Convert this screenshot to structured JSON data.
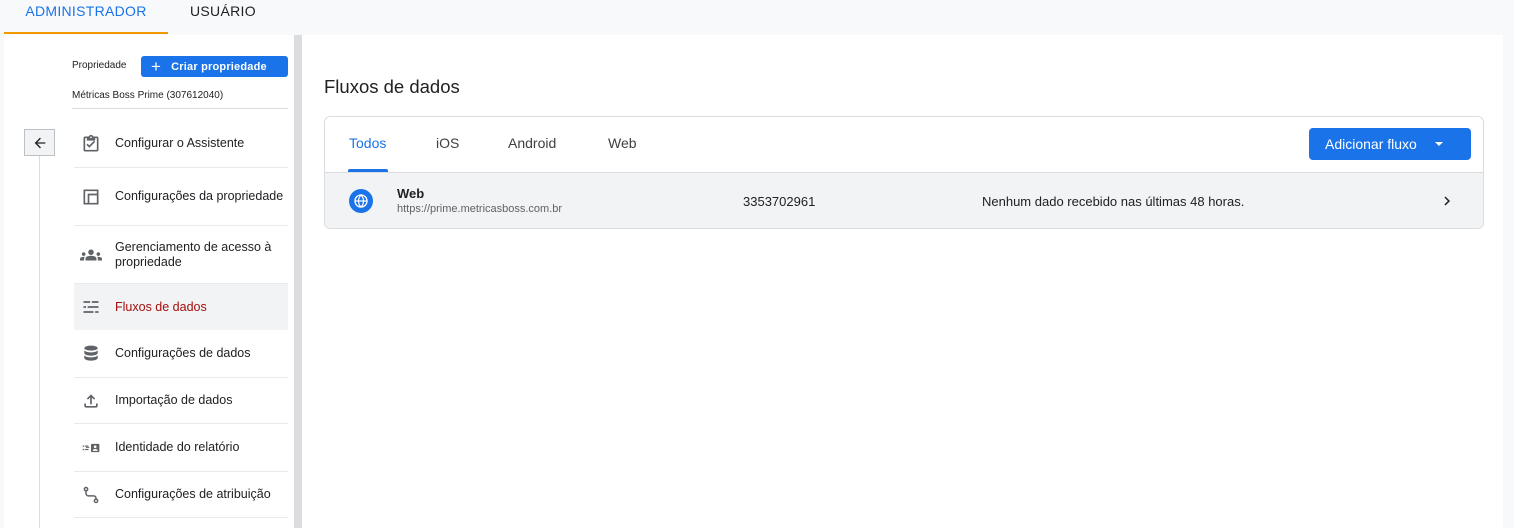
{
  "top_tabs": {
    "admin": "ADMINISTRADOR",
    "user": "USUÁRIO"
  },
  "sidebar": {
    "property_label": "Propriedade",
    "create_property": "Criar propriedade",
    "property_name": "Métricas Boss Prime (307612040)",
    "items": [
      {
        "label": "Configurar o Assistente",
        "icon": "checklist-icon"
      },
      {
        "label": "Configurações da propriedade",
        "icon": "property-settings-icon"
      },
      {
        "label": "Gerenciamento de acesso à propriedade",
        "icon": "people-icon"
      },
      {
        "label": "Fluxos de dados",
        "icon": "data-streams-icon",
        "active": true
      },
      {
        "label": "Configurações de dados",
        "icon": "database-icon"
      },
      {
        "label": "Importação de dados",
        "icon": "upload-icon"
      },
      {
        "label": "Identidade do relatório",
        "icon": "report-identity-icon"
      },
      {
        "label": "Configurações de atribuição",
        "icon": "attribution-icon"
      }
    ]
  },
  "main": {
    "title": "Fluxos de dados",
    "tabs": [
      "Todos",
      "iOS",
      "Android",
      "Web"
    ],
    "active_tab": "Todos",
    "add_button": "Adicionar fluxo",
    "streams": [
      {
        "name": "Web",
        "url": "https://prime.metricasboss.com.br",
        "id": "3353702961",
        "status": "Nenhum dado recebido nas últimas 48 horas.",
        "icon": "globe-icon"
      }
    ]
  },
  "colors": {
    "accent": "#1a73e8",
    "active_nav": "#a50e0e",
    "tab_indicator": "#f29900"
  }
}
